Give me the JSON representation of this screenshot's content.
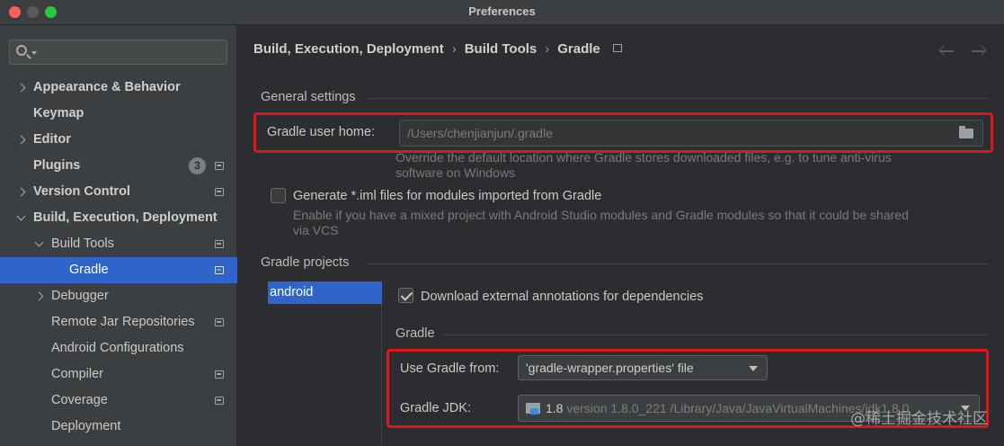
{
  "window": {
    "title": "Preferences"
  },
  "search": {
    "placeholder": ""
  },
  "sidebar": {
    "items": [
      {
        "label": "Appearance & Behavior"
      },
      {
        "label": "Keymap"
      },
      {
        "label": "Editor"
      },
      {
        "label": "Plugins",
        "badge": "3"
      },
      {
        "label": "Version Control"
      },
      {
        "label": "Build, Execution, Deployment"
      },
      {
        "label": "Build Tools"
      },
      {
        "label": "Gradle"
      },
      {
        "label": "Debugger"
      },
      {
        "label": "Remote Jar Repositories"
      },
      {
        "label": "Android Configurations"
      },
      {
        "label": "Compiler"
      },
      {
        "label": "Coverage"
      },
      {
        "label": "Deployment"
      }
    ]
  },
  "breadcrumb": {
    "items": [
      "Build, Execution, Deployment",
      "Build Tools",
      "Gradle"
    ],
    "separator": "›"
  },
  "general": {
    "title": "General settings",
    "user_home_label": "Gradle user home:",
    "user_home_value": "/Users/chenjianjun/.gradle",
    "user_home_hint_line1": "Override the default location where Gradle stores downloaded files, e.g. to tune anti-virus",
    "user_home_hint_line2": "software on Windows",
    "generate_iml_label": "Generate *.iml files for modules imported from Gradle",
    "generate_iml_checked": false,
    "generate_iml_hint_line1": "Enable if you have a mixed project with Android Studio modules and Gradle modules so that it could be shared",
    "generate_iml_hint_line2": "via VCS"
  },
  "projects": {
    "title": "Gradle projects",
    "list": [
      "android"
    ],
    "download_annotations_label": "Download external annotations for dependencies",
    "download_annotations_checked": true,
    "gradle_section_title": "Gradle",
    "use_gradle_from_label": "Use Gradle from:",
    "use_gradle_from_value": "'gradle-wrapper.properties' file",
    "jdk_label": "Gradle JDK:",
    "jdk_version": "1.8",
    "jdk_detail": "version 1.8.0_221 /Library/Java/JavaVirtualMachines/jdk1.8.0_"
  },
  "watermark": "@稀土掘金技术社区",
  "colors": {
    "selection": "#2f65ca",
    "highlight_box": "#e3141b"
  }
}
